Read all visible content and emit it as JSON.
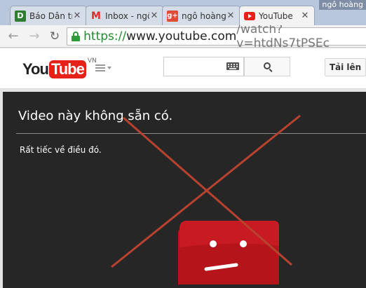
{
  "browser": {
    "profile_name": "ngô hoàng",
    "tabs": [
      {
        "title": "Báo Dân trí",
        "favicon": "dantri-d-icon",
        "favicon_text": "D",
        "favicon_color": "#2e7d32",
        "active": false
      },
      {
        "title": "Inbox - ngô",
        "favicon": "gmail-m-icon",
        "favicon_text": "M",
        "favicon_color": "#d93025",
        "active": false
      },
      {
        "title": "ngô hoàng",
        "favicon": "google-plus-icon",
        "favicon_text": "g+",
        "favicon_color": "#dd4b39",
        "active": false
      },
      {
        "title": "YouTube",
        "favicon": "youtube-play-icon",
        "favicon_color": "#e62117",
        "active": true
      }
    ],
    "url": {
      "scheme": "https://",
      "host": "www.youtube.com",
      "rest": "/watch?v=htdNs7tPSEc"
    }
  },
  "youtube": {
    "logo_you": "You",
    "logo_tube": "Tube",
    "country_code": "VN",
    "upload_label": "Tải lên",
    "brand_color": "#e62117"
  },
  "player": {
    "message": "Video này không sẵn có.",
    "sub_message": "Rất tiếc về điều đó.",
    "overlay_cross_color": "#b7422f"
  }
}
